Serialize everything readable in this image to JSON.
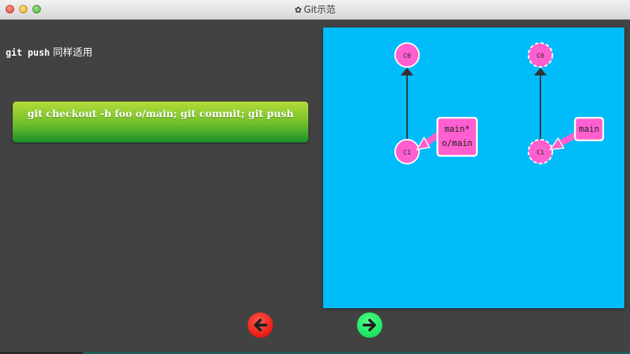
{
  "window": {
    "title": "Git示范",
    "title_icon": "gear-icon"
  },
  "left": {
    "text_code": "git push",
    "text_rest": "同样适用"
  },
  "command_button": {
    "label": "git checkout -b foo o/main; git commit; git push"
  },
  "graph": {
    "background_color": "#00bcf9",
    "node_color": "#ff5fcf",
    "local": {
      "commits": [
        "C0",
        "C1"
      ],
      "branch_label_lines": [
        "main*",
        "o/main"
      ]
    },
    "remote": {
      "commits": [
        "C0",
        "C1"
      ],
      "branch_label_lines": [
        "main"
      ]
    }
  },
  "nav": {
    "back_icon": "arrow-left-icon",
    "back_color": "#ff1a1a",
    "forward_icon": "arrow-right-icon",
    "forward_color": "#00e85a"
  }
}
